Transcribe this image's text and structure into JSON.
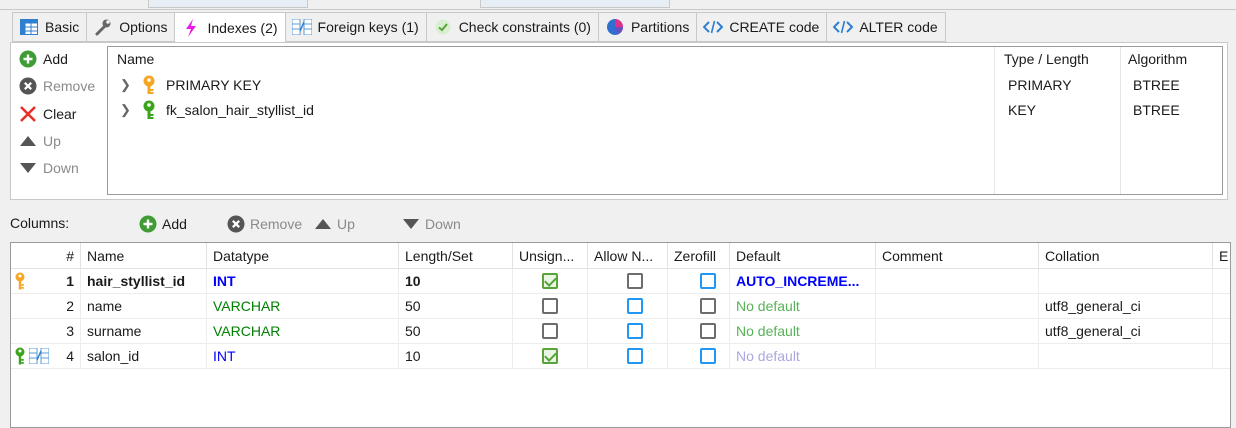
{
  "tabs": [
    {
      "label": "Basic",
      "icon": "table-icon"
    },
    {
      "label": "Options",
      "icon": "wrench-icon"
    },
    {
      "label": "Indexes (2)",
      "icon": "lightning-icon",
      "active": true
    },
    {
      "label": "Foreign keys (1)",
      "icon": "foreign-key-icon"
    },
    {
      "label": "Check constraints (0)",
      "icon": "check-icon"
    },
    {
      "label": "Partitions",
      "icon": "pie-chart-icon"
    },
    {
      "label": "CREATE code",
      "icon": "code-icon"
    },
    {
      "label": "ALTER code",
      "icon": "code-icon"
    }
  ],
  "index_toolbar": {
    "add": "Add",
    "remove": "Remove",
    "clear": "Clear",
    "up": "Up",
    "down": "Down"
  },
  "indexes": {
    "headers": {
      "name": "Name",
      "type": "Type / Length",
      "algorithm": "Algorithm"
    },
    "rows": [
      {
        "name": "PRIMARY KEY",
        "type": "PRIMARY",
        "algorithm": "BTREE",
        "key_color": "#f5a623"
      },
      {
        "name": "fk_salon_hair_styllist_id",
        "type": "KEY",
        "algorithm": "BTREE",
        "key_color": "#3aa41c"
      }
    ]
  },
  "columns_toolbar": {
    "label": "Columns:",
    "add": "Add",
    "remove": "Remove",
    "up": "Up",
    "down": "Down"
  },
  "columns": {
    "headers": {
      "num": "#",
      "name": "Name",
      "datatype": "Datatype",
      "length": "Length/Set",
      "unsigned": "Unsign...",
      "allow_null": "Allow N...",
      "zerofill": "Zerofill",
      "default": "Default",
      "comment": "Comment",
      "collation": "Collation",
      "extra": "E"
    },
    "rows": [
      {
        "num": "1",
        "name": "hair_styllist_id",
        "datatype": "INT",
        "length": "10",
        "unsigned": true,
        "allow_null": false,
        "zerofill": false,
        "default": "AUTO_INCREME...",
        "comment": "",
        "collation": ""
      },
      {
        "num": "2",
        "name": "name",
        "datatype": "VARCHAR",
        "length": "50",
        "unsigned": false,
        "allow_null": false,
        "zerofill": false,
        "default": "No default",
        "comment": "",
        "collation": "utf8_general_ci"
      },
      {
        "num": "3",
        "name": "surname",
        "datatype": "VARCHAR",
        "length": "50",
        "unsigned": false,
        "allow_null": false,
        "zerofill": false,
        "default": "No default",
        "comment": "",
        "collation": "utf8_general_ci"
      },
      {
        "num": "4",
        "name": "salon_id",
        "datatype": "INT",
        "length": "10",
        "unsigned": true,
        "allow_null": false,
        "zerofill": false,
        "default": "No default",
        "comment": "",
        "collation": ""
      }
    ]
  },
  "colors": {
    "primary_key": "#f5a623",
    "foreign_key": "#3aa41c",
    "int_type": "#0000ff",
    "varchar_type": "#008000",
    "checkbox_checked": "#5aa23a",
    "checkbox_blue": "#2196f3"
  }
}
